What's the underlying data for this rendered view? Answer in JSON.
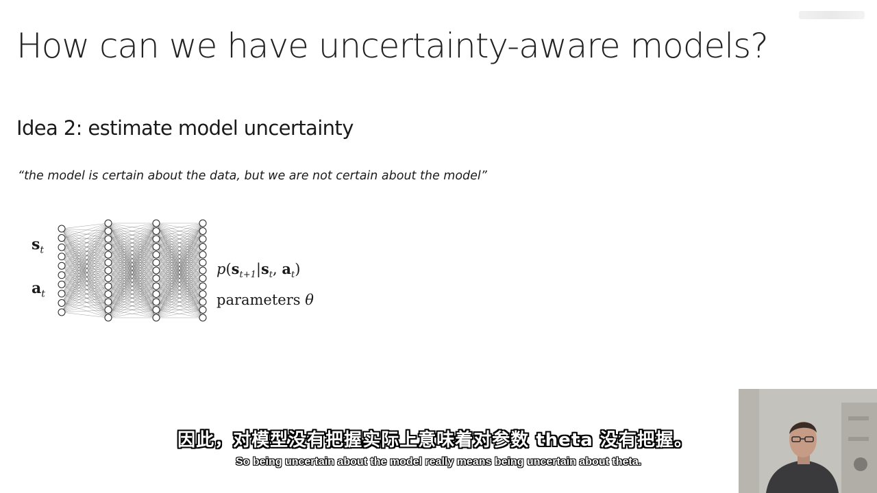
{
  "slide": {
    "title": "How can we have uncertainty-aware models?",
    "idea_heading": "Idea 2: estimate model uncertainty",
    "quote": "“the model is certain about the data, but we are not certain about the model”"
  },
  "figure": {
    "input_state": {
      "symbol": "s",
      "subscript": "t"
    },
    "input_action": {
      "symbol": "a",
      "subscript": "t"
    },
    "output_distribution": {
      "func": "p",
      "open": "(",
      "s1": "s",
      "s1_sub": "t+1",
      "bar": "|",
      "s2": "s",
      "s2_sub": "t",
      "comma": ", ",
      "a": "a",
      "a_sub": "t",
      "close": ")"
    },
    "parameters": {
      "text": "parameters",
      "theta": "θ"
    },
    "layers": [
      10,
      13,
      13,
      13
    ]
  },
  "subtitles": {
    "chinese": "因此，对模型没有把握实际上意味着对参数 theta 没有把握。",
    "english": "So being uncertain about the model really means being uncertain about theta."
  }
}
